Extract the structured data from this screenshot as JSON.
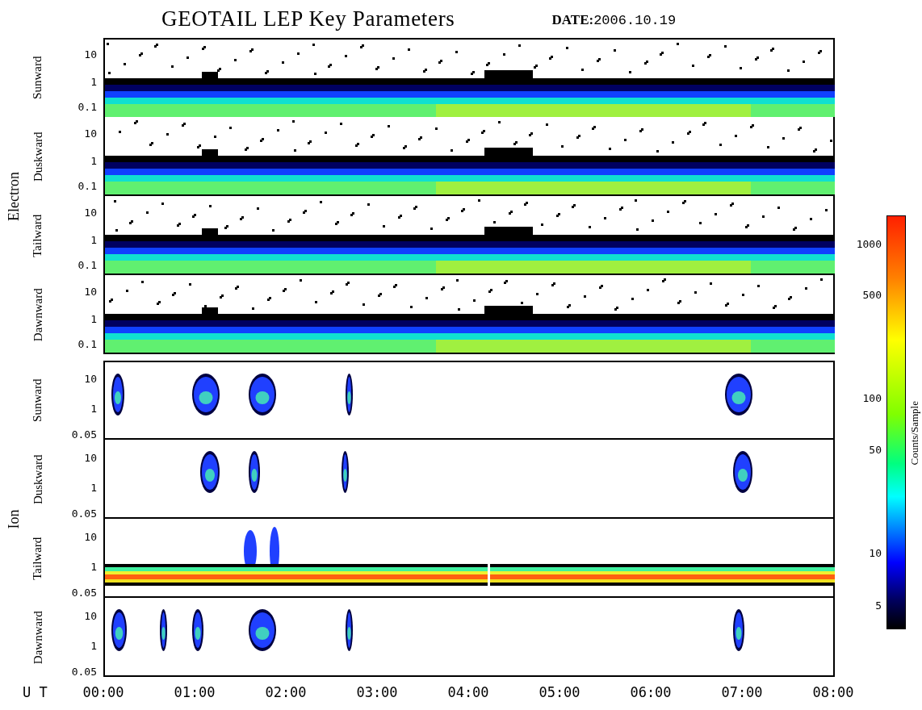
{
  "title": "GEOTAIL LEP Key Parameters",
  "date_label": "DATE:",
  "date": "2006.10.19",
  "groups": [
    {
      "name": "Electron",
      "panels": [
        {
          "label": "Sunward",
          "kind": "band",
          "yticks": [
            "10",
            "1",
            "0.1"
          ]
        },
        {
          "label": "Duskward",
          "kind": "band",
          "yticks": [
            "10",
            "1",
            "0.1"
          ]
        },
        {
          "label": "Tailward",
          "kind": "band",
          "yticks": [
            "10",
            "1",
            "0.1"
          ]
        },
        {
          "label": "Dawnward",
          "kind": "band",
          "yticks": [
            "10",
            "1",
            "0.1"
          ]
        }
      ]
    },
    {
      "name": "Ion",
      "panels": [
        {
          "label": "Sunward",
          "kind": "patches",
          "yticks": [
            "10",
            "1",
            "0.05"
          ]
        },
        {
          "label": "Duskward",
          "kind": "patches",
          "yticks": [
            "10",
            "1",
            "0.05"
          ]
        },
        {
          "label": "Tailward",
          "kind": "beam",
          "yticks": [
            "10",
            "1",
            "0.05"
          ]
        },
        {
          "label": "Dawnward",
          "kind": "patches",
          "yticks": [
            "10",
            "1",
            "0.05"
          ]
        }
      ]
    }
  ],
  "time_axis": {
    "label": "U T",
    "ticks": [
      "00:00",
      "01:00",
      "02:00",
      "03:00",
      "04:00",
      "05:00",
      "06:00",
      "07:00",
      "08:00"
    ]
  },
  "colorbar": {
    "title": "Counts/Sample",
    "ticks": [
      "1000",
      "500",
      "100",
      "50",
      "10",
      "5"
    ]
  }
}
